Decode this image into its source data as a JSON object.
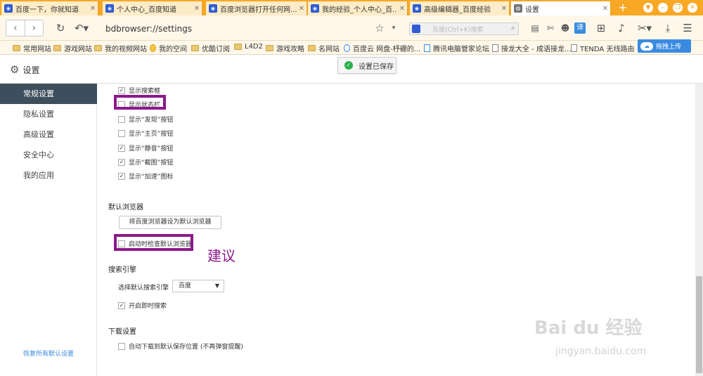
{
  "tabs": [
    {
      "label": "百度一下，你就知道"
    },
    {
      "label": "个人中心_百度知道"
    },
    {
      "label": "百度浏览器打开任何网..."
    },
    {
      "label": "我的经验_个人中心_百..."
    },
    {
      "label": "高级编辑器_百度经验"
    },
    {
      "label": "设置"
    }
  ],
  "toolbar": {
    "url": "bdbrowser://settings",
    "search_placeholder": "百度(Ctrl+K)搜索",
    "translate": "译"
  },
  "bookmarks": [
    "常用网站",
    "游戏网站",
    "我的视频网站",
    "我的空间",
    "优酷订阅",
    "L4D2",
    "游戏攻略",
    "名网站",
    "百度云 网盘-杼硼的...",
    "腾讯电脑管家论坛",
    "接龙大全 - 成语接龙...",
    "TENDA 无线路由"
  ],
  "upload_label": "拖拽上传",
  "page": {
    "title": "设置",
    "toast": "设置已保存"
  },
  "sidebar": {
    "items": [
      "常规设置",
      "隐私设置",
      "高级设置",
      "安全中心",
      "我的应用"
    ],
    "restore": "恢复所有默认设置"
  },
  "content": {
    "toolbar_opts": [
      {
        "label": "显示搜索框",
        "checked": "✓"
      },
      {
        "label": "显示状态栏",
        "checked": ""
      },
      {
        "label": "显示“发现”按钮",
        "checked": ""
      },
      {
        "label": "显示“主页”按钮",
        "checked": ""
      },
      {
        "label": "显示“静音”按钮",
        "checked": "✓"
      },
      {
        "label": "显示“截图”按钮",
        "checked": "✓"
      },
      {
        "label": "显示“加速”图标",
        "checked": "✓"
      }
    ],
    "default_browser": {
      "title": "默认浏览器",
      "button": "将百度浏览器设为默认浏览器",
      "check_label": "启动时检查默认浏览器",
      "checked": ""
    },
    "annotation": "建议",
    "search": {
      "title": "搜索引擎",
      "select_label": "选择默认搜索引擎",
      "select_value": "百度",
      "instant_label": "开启即时搜索",
      "instant_checked": "✓"
    },
    "download": {
      "title": "下载设置",
      "auto_label": "自动下载到默认保存位置 (不再弹窗提醒)",
      "auto_checked": ""
    }
  },
  "watermark": {
    "brand": "Bai du 经验",
    "url": "jingyan.baidu.com"
  }
}
